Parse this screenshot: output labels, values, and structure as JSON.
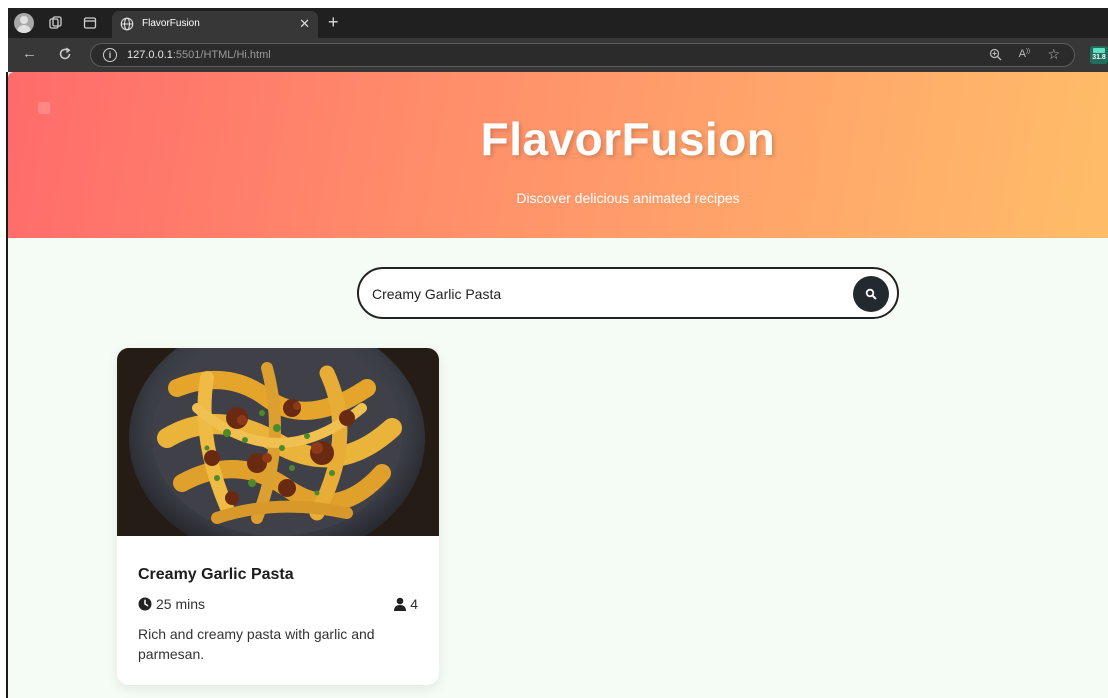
{
  "browser": {
    "tab_title": "FlavorFusion",
    "url_host": "127.0.0.1",
    "url_rest": ":5501/HTML/Hi.html",
    "extension_badge": "31.8"
  },
  "hero": {
    "title": "FlavorFusion",
    "subtitle": "Discover delicious animated recipes",
    "gradient": [
      "#ff6b6b",
      "#ffbd68"
    ]
  },
  "search": {
    "value": "Creamy Garlic Pasta",
    "icon": "search-icon"
  },
  "recipes": [
    {
      "title": "Creamy Garlic Pasta",
      "time": "25 mins",
      "servings": "4",
      "description": "Rich and creamy pasta with garlic and parmesan."
    }
  ],
  "colors": {
    "page_background": "#f4fcf5",
    "search_button": "#222a30"
  }
}
